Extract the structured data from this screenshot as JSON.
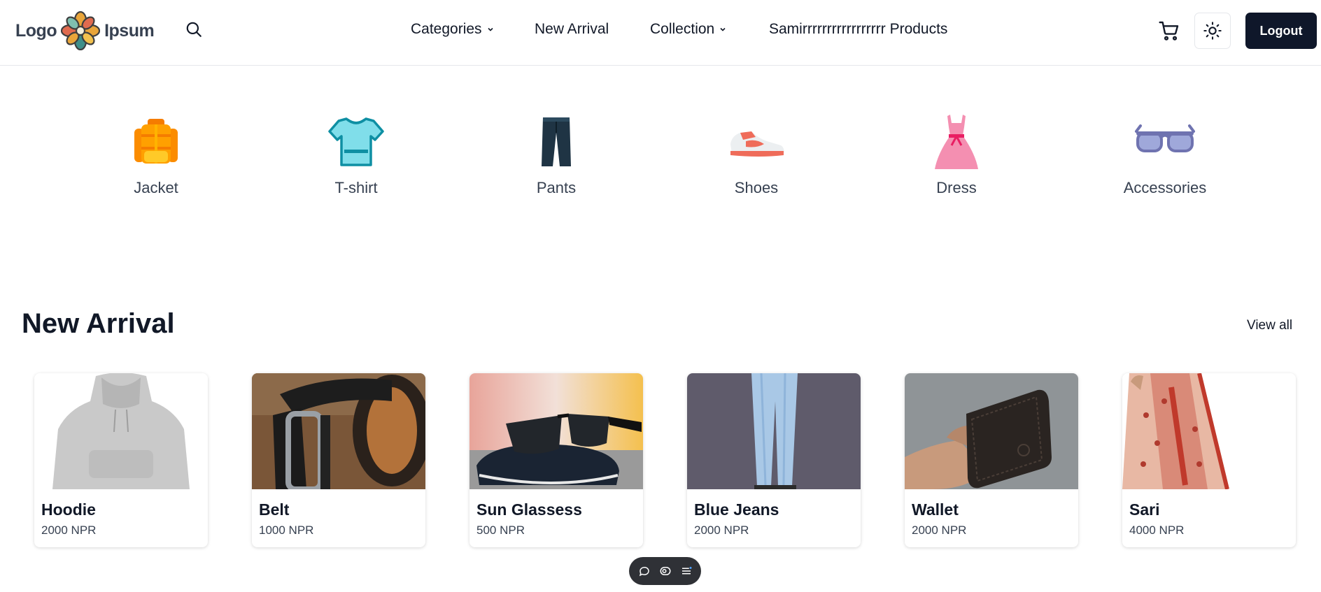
{
  "header": {
    "logo": {
      "word_left": "Logo",
      "word_right": "Ipsum"
    },
    "search_icon": "search-icon",
    "nav": [
      {
        "label": "Categories",
        "has_dropdown": true
      },
      {
        "label": "New Arrival",
        "has_dropdown": false
      },
      {
        "label": "Collection",
        "has_dropdown": true
      },
      {
        "label": "Samirrrrrrrrrrrrrrrrr Products",
        "has_dropdown": false
      }
    ],
    "cart_icon": "cart-icon",
    "theme_icon": "sun-icon",
    "logout_label": "Logout"
  },
  "categories": [
    {
      "label": "Jacket",
      "icon": "jacket-icon"
    },
    {
      "label": "T-shirt",
      "icon": "tshirt-icon"
    },
    {
      "label": "Pants",
      "icon": "pants-icon"
    },
    {
      "label": "Shoes",
      "icon": "shoes-icon"
    },
    {
      "label": "Dress",
      "icon": "dress-icon"
    },
    {
      "label": "Accessories",
      "icon": "glasses-icon"
    }
  ],
  "new_arrival": {
    "title": "New Arrival",
    "view_all": "View all",
    "products": [
      {
        "name": "Hoodie",
        "price": "2000 NPR"
      },
      {
        "name": "Belt",
        "price": "1000 NPR"
      },
      {
        "name": "Sun Glassess",
        "price": "500 NPR"
      },
      {
        "name": "Blue Jeans",
        "price": "2000 NPR"
      },
      {
        "name": "Wallet",
        "price": "2000 NPR"
      },
      {
        "name": "Sari",
        "price": "4000 NPR"
      }
    ]
  },
  "floating_toolbar": {
    "icons": [
      "comment-icon",
      "eye-icon",
      "menu-icon"
    ]
  },
  "colors": {
    "primary_dark": "#0f172a",
    "text": "#111827",
    "muted": "#374151",
    "border": "#e5e7eb"
  }
}
